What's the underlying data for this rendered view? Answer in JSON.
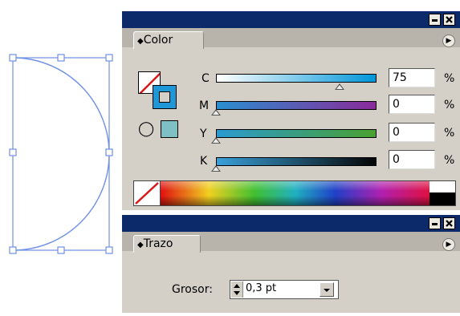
{
  "color_panel": {
    "tab_label": "Color",
    "channels": [
      {
        "letter": "C",
        "value": "75",
        "level": 0.75,
        "gradient": [
          "#ffffff",
          "#0096d8"
        ]
      },
      {
        "letter": "M",
        "value": "0",
        "level": 0,
        "gradient": [
          "#2a8fd0",
          "#8a2a9a"
        ]
      },
      {
        "letter": "Y",
        "value": "0",
        "level": 0,
        "gradient": [
          "#2a9ad0",
          "#4aa030"
        ]
      },
      {
        "letter": "K",
        "value": "0",
        "level": 0,
        "gradient": [
          "#3aa0d8",
          "#050505"
        ]
      }
    ],
    "unit": "%",
    "fill_color": "#7fc0c4",
    "stroke_color": "#1f96d6"
  },
  "stroke_panel": {
    "tab_label": "Trazo",
    "weight_label": "Grosor:",
    "weight_value": "0,3 pt"
  },
  "icons": [
    "tab-grip-icon",
    "minimize-icon",
    "close-icon",
    "panel-menu-icon",
    "cube-icon",
    "spinner-icon",
    "dropdown-arrow-icon",
    "swap-none-icon"
  ],
  "accent_color": "#5b7fe0"
}
